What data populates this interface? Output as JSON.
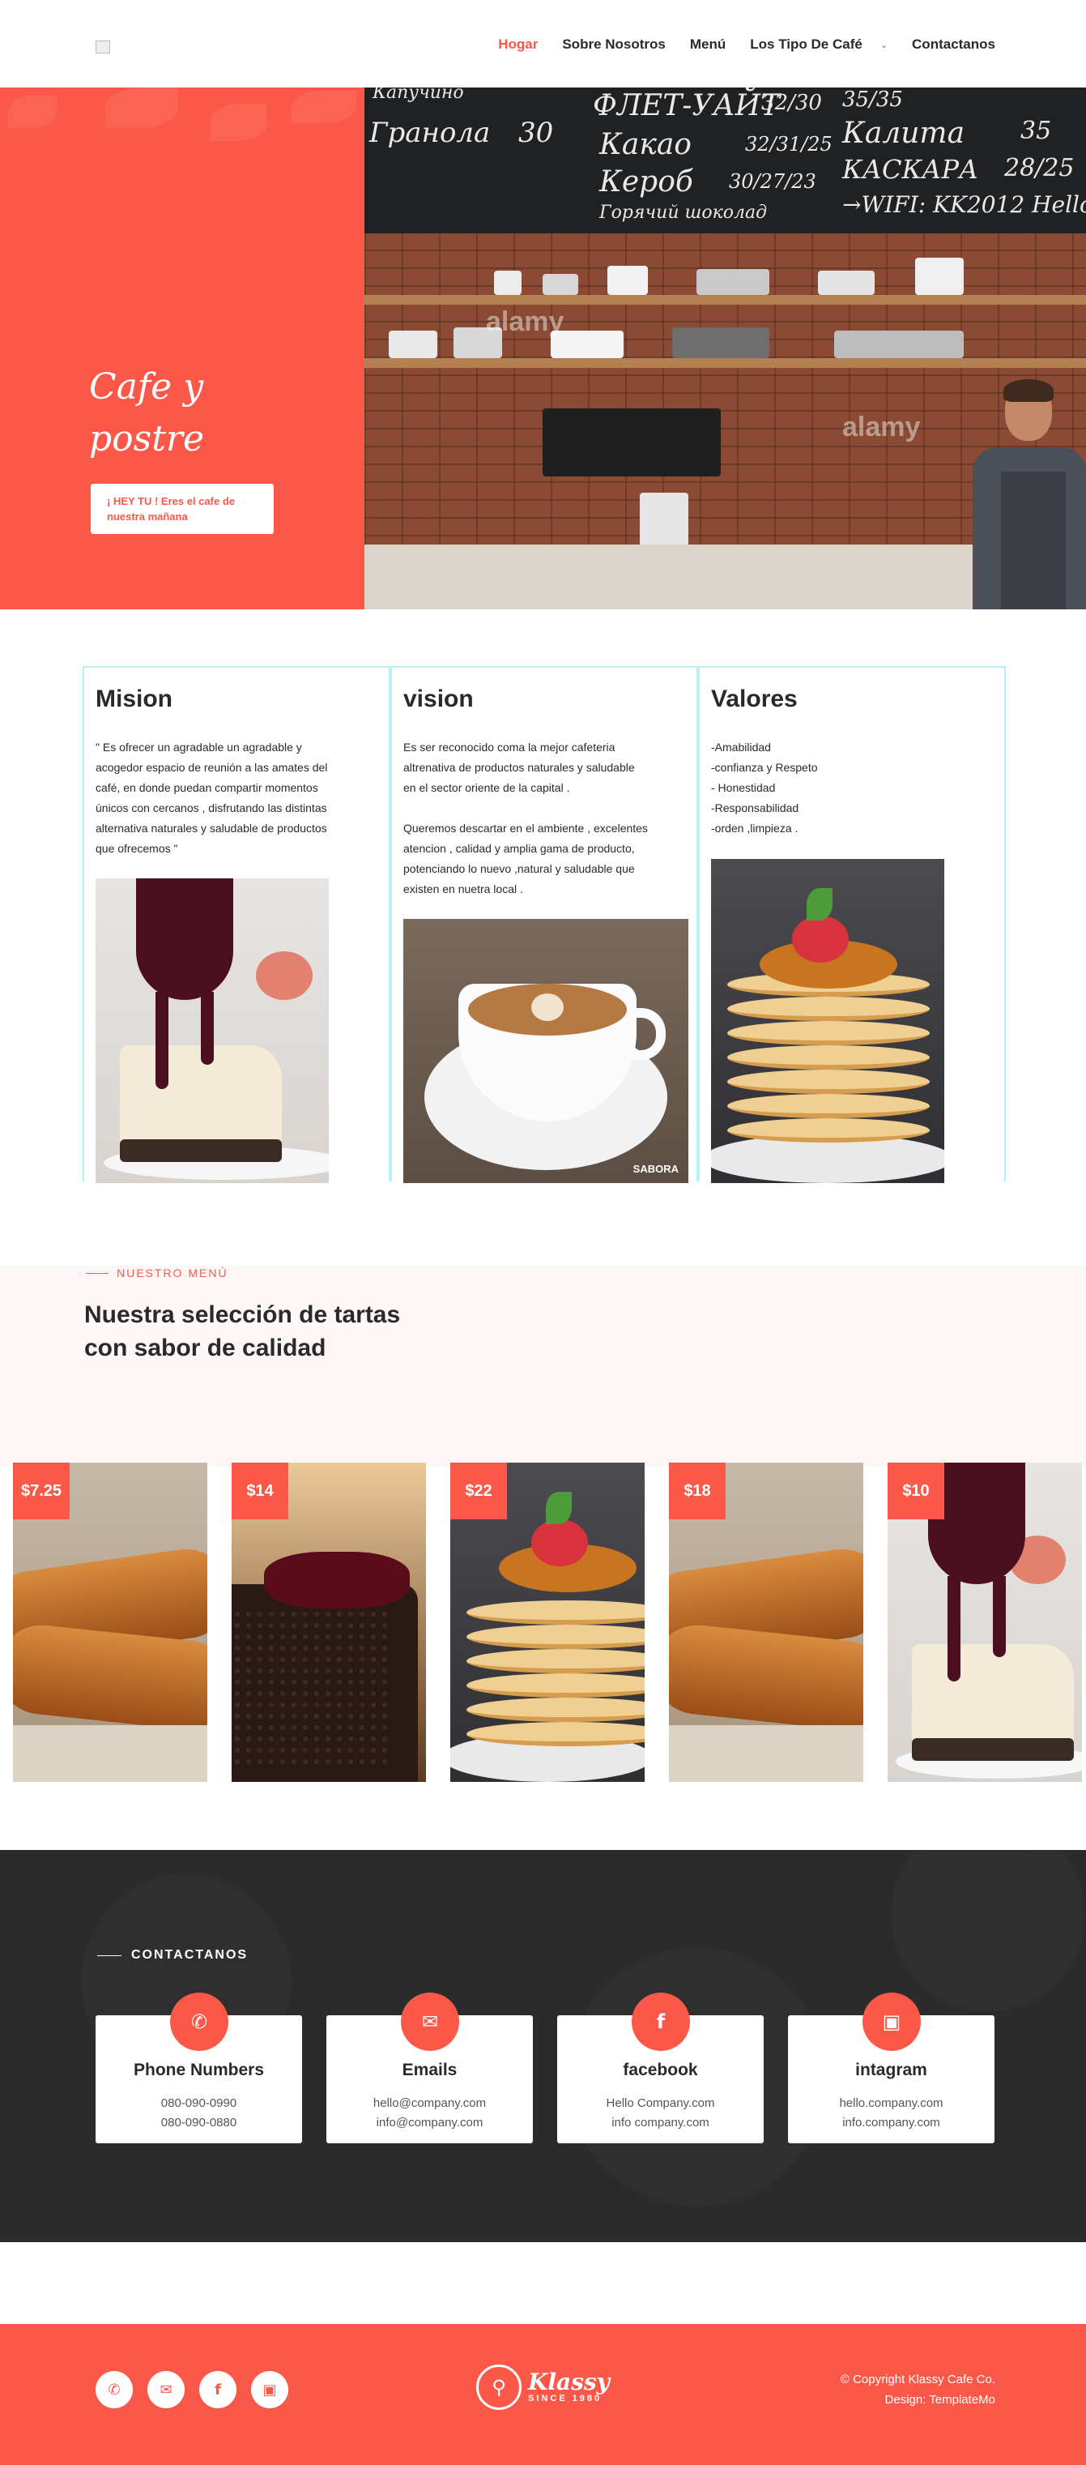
{
  "header": {
    "nav": [
      {
        "label": "Hogar",
        "active": true
      },
      {
        "label": "Sobre Nosotros"
      },
      {
        "label": "Menú"
      },
      {
        "label": "Los Tipo De Café"
      },
      {
        "label": "Contactanos"
      }
    ],
    "dropdown_glyph": "⌄"
  },
  "hero": {
    "title_line1": "Cafe y",
    "title_line2": "postre",
    "button_line1": "¡ HEY TU ! Eres el cafe de",
    "button_line2": "nuestra mañana",
    "chalkboard": [
      "ФЛЕТ-УАЙТ",
      "32/30",
      "Какао",
      "32/31/25",
      "Кероб",
      "30/27/23",
      "Горячий шоколад",
      "30",
      "Калита",
      "35",
      "КАСКАРА",
      "28/25",
      "→WIFI: KK2012 Hello",
      "Гранола",
      "Капучино",
      "35/35"
    ],
    "watermark": "alamy",
    "accent": "#fb5849"
  },
  "about": [
    {
      "title": "Mision",
      "text": "\" Es ofrecer un agradable un agradable y\nacogedor espacio de reunión a las amates del\ncafé, en donde puedan compartir momentos\núnicos con cercanos , disfrutando las distintas\nalternativa naturales y saludable de productos\nque ofrecemos \""
    },
    {
      "title": "vision",
      "text": "Es ser reconocido coma la mejor cafeteria\naltrenativa de productos naturales y saludable\nen el sector oriente de la capital .\n\nQueremos descartar en el ambiente , excelentes\natencion , calidad y amplia gama de producto,\npotenciando lo nuevo ,natural y saludable que\nexisten en nuetra local ."
    },
    {
      "title": "Valores",
      "text": "-Amabilidad\n-confianza y Respeto\n- Honestidad\n-Responsabilidad\n-orden ,limpieza ."
    }
  ],
  "coffee_brand": "SABORA",
  "menu": {
    "label": "NUESTRO MENÚ",
    "title": "Nuestra selección de tartas con sabor de calidad",
    "items": [
      {
        "price": "$7.25",
        "image": "bread"
      },
      {
        "price": "$14",
        "image": "chocolate-cake"
      },
      {
        "price": "$22",
        "image": "pancakes"
      },
      {
        "price": "$18",
        "image": "bread"
      },
      {
        "price": "$10",
        "image": "cheesecake"
      }
    ]
  },
  "contact": {
    "label": "CONTACTANOS",
    "cards": [
      {
        "icon": "phone-icon",
        "title": "Phone Numbers",
        "line1": "080-090-0990",
        "line2": "080-090-0880"
      },
      {
        "icon": "envelope-icon",
        "title": "Emails",
        "line1": "hello@company.com",
        "line2": "info@company.com"
      },
      {
        "icon": "facebook-icon",
        "title": "facebook",
        "line1": "Hello Company.com",
        "line2": "info company.com"
      },
      {
        "icon": "instagram-icon",
        "title": "intagram",
        "line1": "hello.company.com",
        "line2": "info.company.com"
      }
    ]
  },
  "footer": {
    "brand": "Klassy",
    "since": "SINCE 1980",
    "copyright": "© Copyright Klassy Cafe Co.",
    "design": "Design: TemplateMo"
  }
}
